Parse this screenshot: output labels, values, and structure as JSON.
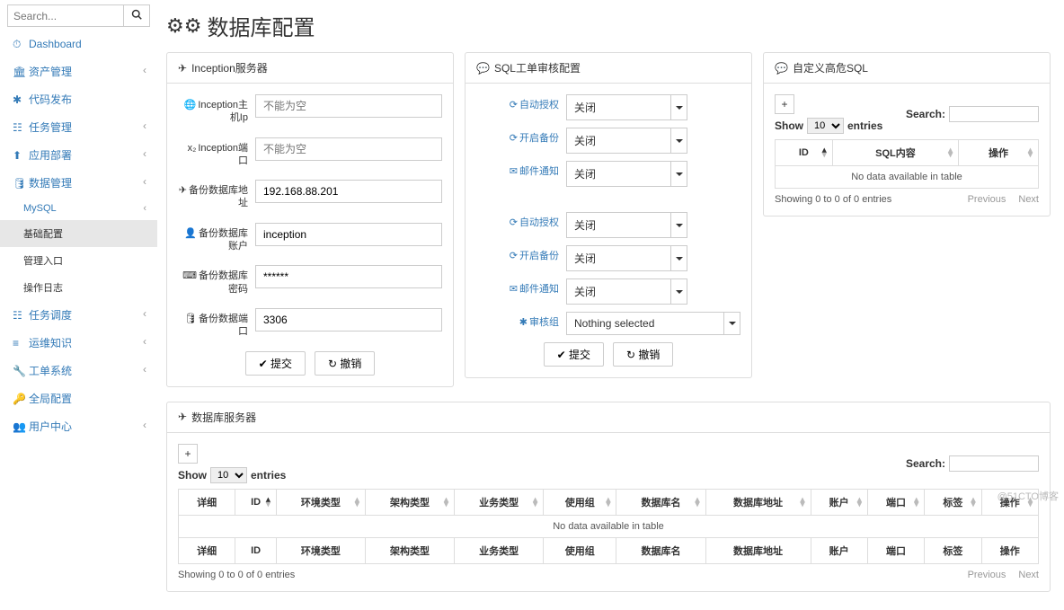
{
  "search_placeholder": "Search...",
  "page_title": "数据库配置",
  "sidebar": {
    "items": [
      {
        "icon": "⏱",
        "label": "Dashboard",
        "chev": false
      },
      {
        "icon": "🏛",
        "label": "资产管理",
        "chev": true
      },
      {
        "icon": "✱",
        "label": "代码发布",
        "chev": false
      },
      {
        "icon": "☷",
        "label": "任务管理",
        "chev": true
      },
      {
        "icon": "⬆",
        "label": "应用部署",
        "chev": true
      },
      {
        "icon": "🛢",
        "label": "数据管理",
        "chev": true
      },
      {
        "icon": "",
        "label": "MySQL",
        "chev": true,
        "sub": true,
        "link": true
      },
      {
        "icon": "",
        "label": "基础配置",
        "chev": false,
        "sub": true,
        "active": true
      },
      {
        "icon": "",
        "label": "管理入口",
        "chev": false,
        "sub": true
      },
      {
        "icon": "",
        "label": "操作日志",
        "chev": false,
        "sub": true
      },
      {
        "icon": "☷",
        "label": "任务调度",
        "chev": true
      },
      {
        "icon": "≡",
        "label": "运维知识",
        "chev": true
      },
      {
        "icon": "🔧",
        "label": "工单系统",
        "chev": true
      },
      {
        "icon": "🔑",
        "label": "全局配置",
        "chev": false
      },
      {
        "icon": "👥",
        "label": "用户中心",
        "chev": true
      }
    ]
  },
  "p1": {
    "title": "Inception服务器",
    "fields": [
      {
        "icon": "🌐",
        "label": "Inception主机Ip",
        "ph": "不能为空",
        "val": ""
      },
      {
        "icon": "x₂",
        "label": "Inception端口",
        "ph": "不能为空",
        "val": ""
      },
      {
        "icon": "✈",
        "label": "备份数据库地址",
        "ph": "",
        "val": "192.168.88.201"
      },
      {
        "icon": "👤",
        "label": "备份数据库账户",
        "ph": "",
        "val": "inception"
      },
      {
        "icon": "⌨",
        "label": "备份数据库密码",
        "ph": "",
        "val": "******"
      },
      {
        "icon": "🛢",
        "label": "备份数据端口",
        "ph": "",
        "val": "3306"
      }
    ],
    "submit": "提交",
    "reset": "撤销"
  },
  "p2": {
    "title": "SQL工单审核配置",
    "group1": [
      {
        "icon": "⟳",
        "label": "自动授权",
        "val": "关闭"
      },
      {
        "icon": "⟳",
        "label": "开启备份",
        "val": "关闭"
      },
      {
        "icon": "✉",
        "label": "邮件通知",
        "val": "关闭"
      }
    ],
    "group2": [
      {
        "icon": "⟳",
        "label": "自动授权",
        "val": "关闭"
      },
      {
        "icon": "⟳",
        "label": "开启备份",
        "val": "关闭"
      },
      {
        "icon": "✉",
        "label": "邮件通知",
        "val": "关闭"
      }
    ],
    "audit": {
      "icon": "✱",
      "label": "审核组",
      "val": "Nothing selected"
    },
    "submit": "提交",
    "reset": "撤销"
  },
  "p3": {
    "title": "自定义高危SQL",
    "show": "Show",
    "entries": "entries",
    "entries_val": "10",
    "search": "Search:",
    "cols": [
      "ID",
      "SQL内容",
      "操作"
    ],
    "nodata": "No data available in table",
    "info": "Showing 0 to 0 of 0 entries",
    "prev": "Previous",
    "next": "Next"
  },
  "p4": {
    "title": "数据库服务器",
    "show": "Show",
    "entries": "entries",
    "entries_val": "10",
    "search": "Search:",
    "cols": [
      "详细",
      "ID",
      "环境类型",
      "架构类型",
      "业务类型",
      "使用组",
      "数据库名",
      "数据库地址",
      "账户",
      "端口",
      "标签",
      "操作"
    ],
    "nodata": "No data available in table",
    "info": "Showing 0 to 0 of 0 entries",
    "prev": "Previous",
    "next": "Next"
  },
  "watermark": "@51CTO博客"
}
